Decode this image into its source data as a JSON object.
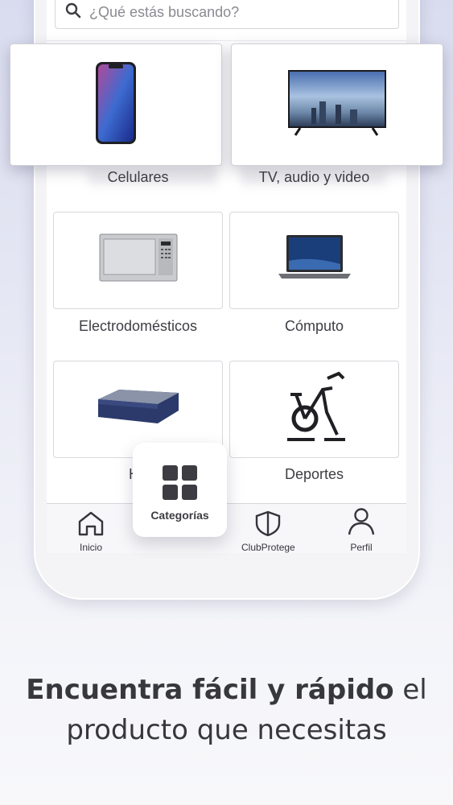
{
  "search": {
    "placeholder": "¿Qué estás buscando?"
  },
  "categories": [
    {
      "label": "Celulares",
      "icon": "smartphone-icon"
    },
    {
      "label": "TV, audio y video",
      "icon": "tv-icon"
    },
    {
      "label": "Electrodomésticos",
      "icon": "microwave-icon"
    },
    {
      "label": "Cómputo",
      "icon": "laptop-icon"
    },
    {
      "label": "Ho",
      "icon": "mattress-icon"
    },
    {
      "label": "Deportes",
      "icon": "exercise-bike-icon"
    }
  ],
  "bottom_nav": {
    "inicio": "Inicio",
    "categorias": "Categorías",
    "clubprotege": "ClubProtege",
    "perfil": "Perfil"
  },
  "tagline": {
    "bold_part": "Encuentra fácil y rápido",
    "rest_part": " el",
    "line2": "producto que necesitas"
  },
  "colors": {
    "text": "#37373d",
    "border": "#d8d8de",
    "background": "#e6e8f4"
  }
}
